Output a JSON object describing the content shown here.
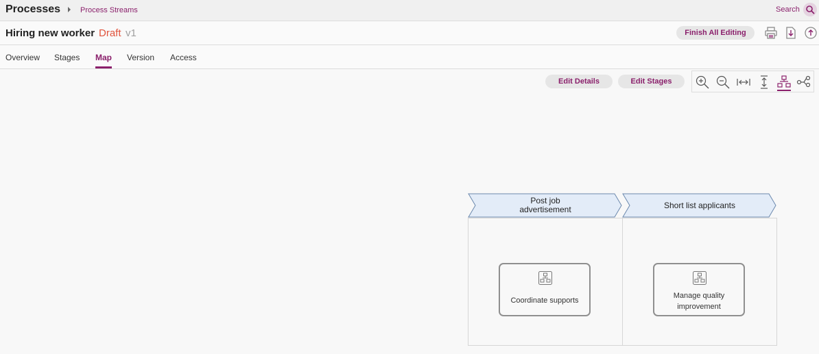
{
  "breadcrumb": {
    "root": "Processes",
    "current": "Process Streams"
  },
  "search": {
    "label": "Search",
    "icon": "search-icon"
  },
  "process": {
    "name": "Hiring new worker",
    "status": "Draft",
    "version": "v1"
  },
  "header_actions": {
    "finish_label": "Finish All Editing",
    "icons": [
      "print-icon",
      "download-icon",
      "upload-icon"
    ]
  },
  "tabs": [
    {
      "label": "Overview"
    },
    {
      "label": "Stages"
    },
    {
      "label": "Map",
      "active": true
    },
    {
      "label": "Version"
    },
    {
      "label": "Access"
    }
  ],
  "map_toolbar": {
    "edit_details_label": "Edit Details",
    "edit_stages_label": "Edit Stages",
    "tools": [
      "zoom-in-icon",
      "zoom-out-icon",
      "fit-width-icon",
      "fit-height-icon",
      "hierarchy-view-icon",
      "flow-view-icon"
    ],
    "active_tool": "hierarchy-view-icon"
  },
  "stages": [
    {
      "name": "Post job advertisement",
      "activities": [
        {
          "label": "Coordinate supports",
          "icon": "process-map-icon"
        }
      ]
    },
    {
      "name": "Short list applicants",
      "activities": [
        {
          "label": "Manage quality improvement",
          "icon": "process-map-icon"
        }
      ]
    }
  ],
  "colors": {
    "accent": "#8a1f6b",
    "draft": "#e0533c",
    "stage_fill": "#e3ecf8",
    "stage_stroke": "#6b88ad"
  }
}
